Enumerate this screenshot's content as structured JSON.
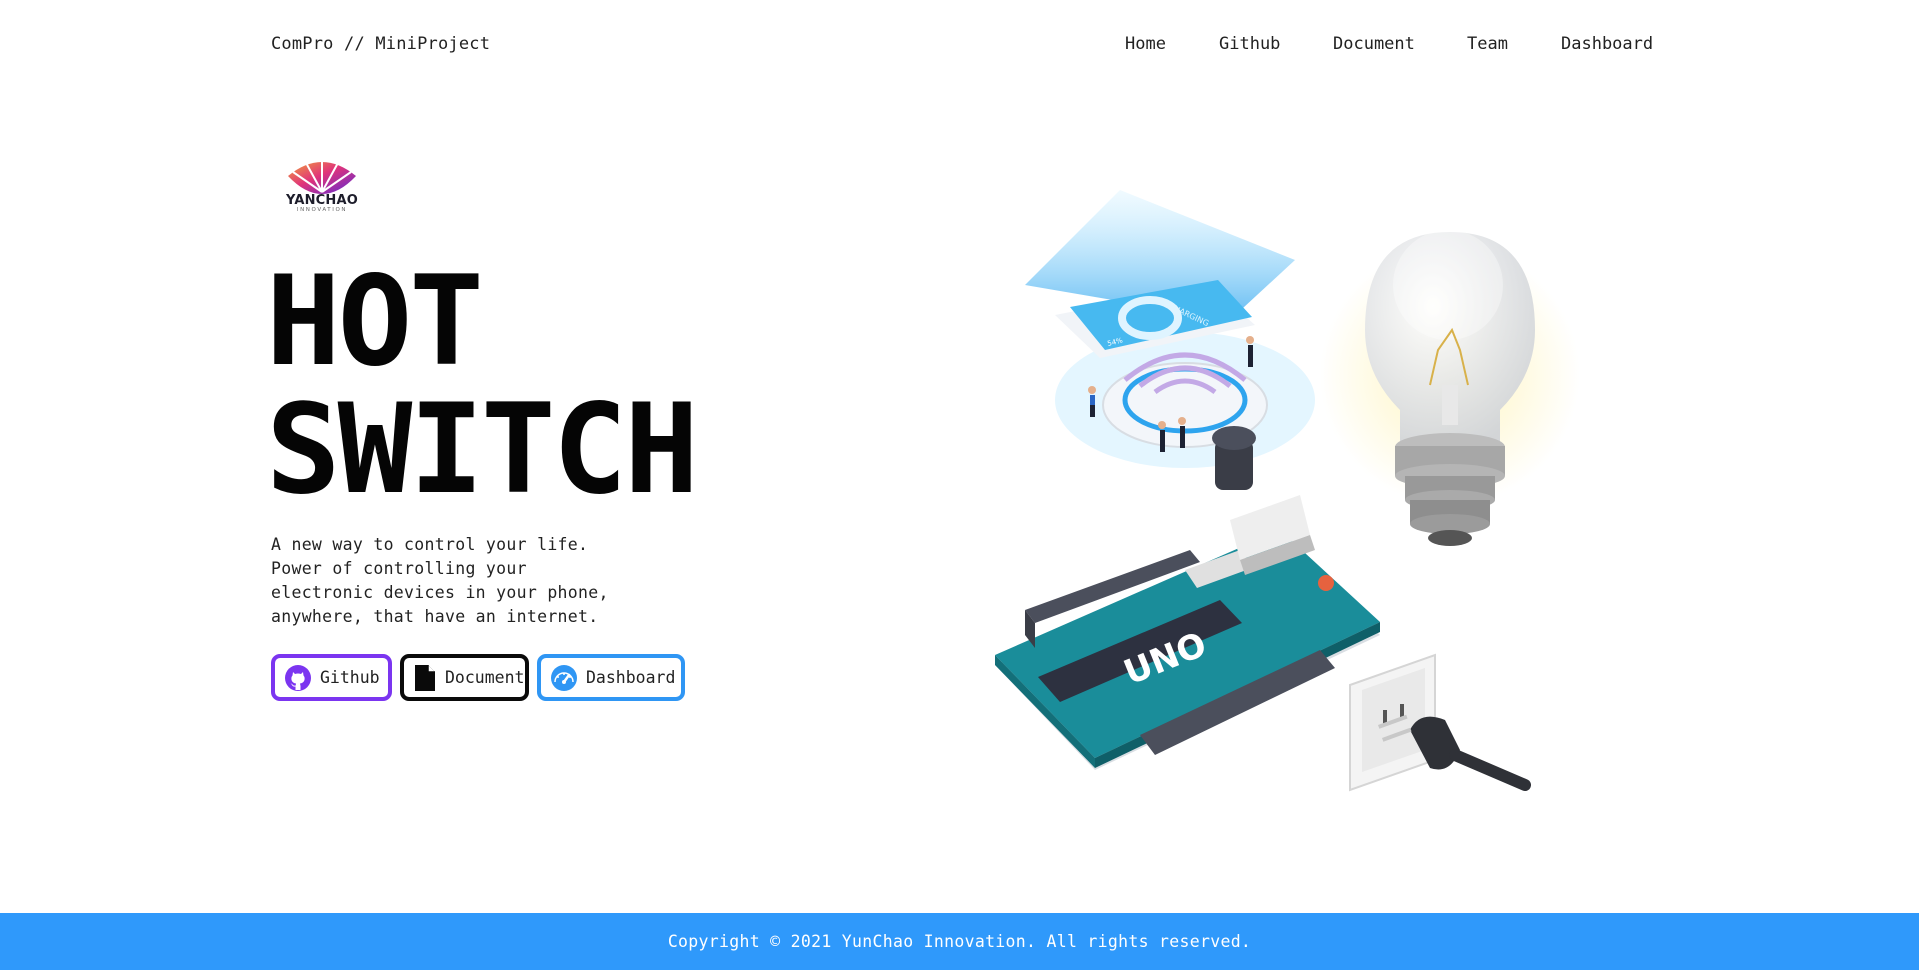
{
  "nav": {
    "brand": "ComPro // MiniProject",
    "links": [
      "Home",
      "Github",
      "Document",
      "Team",
      "Dashboard"
    ]
  },
  "logo": {
    "name": "YANCHAO",
    "sub": "INNOVATION"
  },
  "hero": {
    "title_lines": [
      "HOT",
      "SWITCH"
    ],
    "description_lines": [
      "A new way to control your life.",
      "Power of controlling your",
      "electronic devices in your phone,",
      "anywhere, that have an internet."
    ],
    "buttons": [
      {
        "label": "Github",
        "icon": "github-icon",
        "border_color": "#7b35f0"
      },
      {
        "label": "Document",
        "icon": "document-icon",
        "border_color": "#0a0a0a"
      },
      {
        "label": "Dashboard",
        "icon": "dashboard-icon",
        "border_color": "#2f96f4"
      }
    ]
  },
  "illustration": {
    "board_label": "UNO",
    "phone_screen_label": "CHARGING",
    "phone_percent": "54%"
  },
  "footer": {
    "text": "Copyright © 2021 YunChao Innovation. All rights reserved."
  },
  "colors": {
    "accent_blue": "#2f99fb",
    "accent_purple": "#7b35f0",
    "board_teal": "#1a8d9a"
  }
}
